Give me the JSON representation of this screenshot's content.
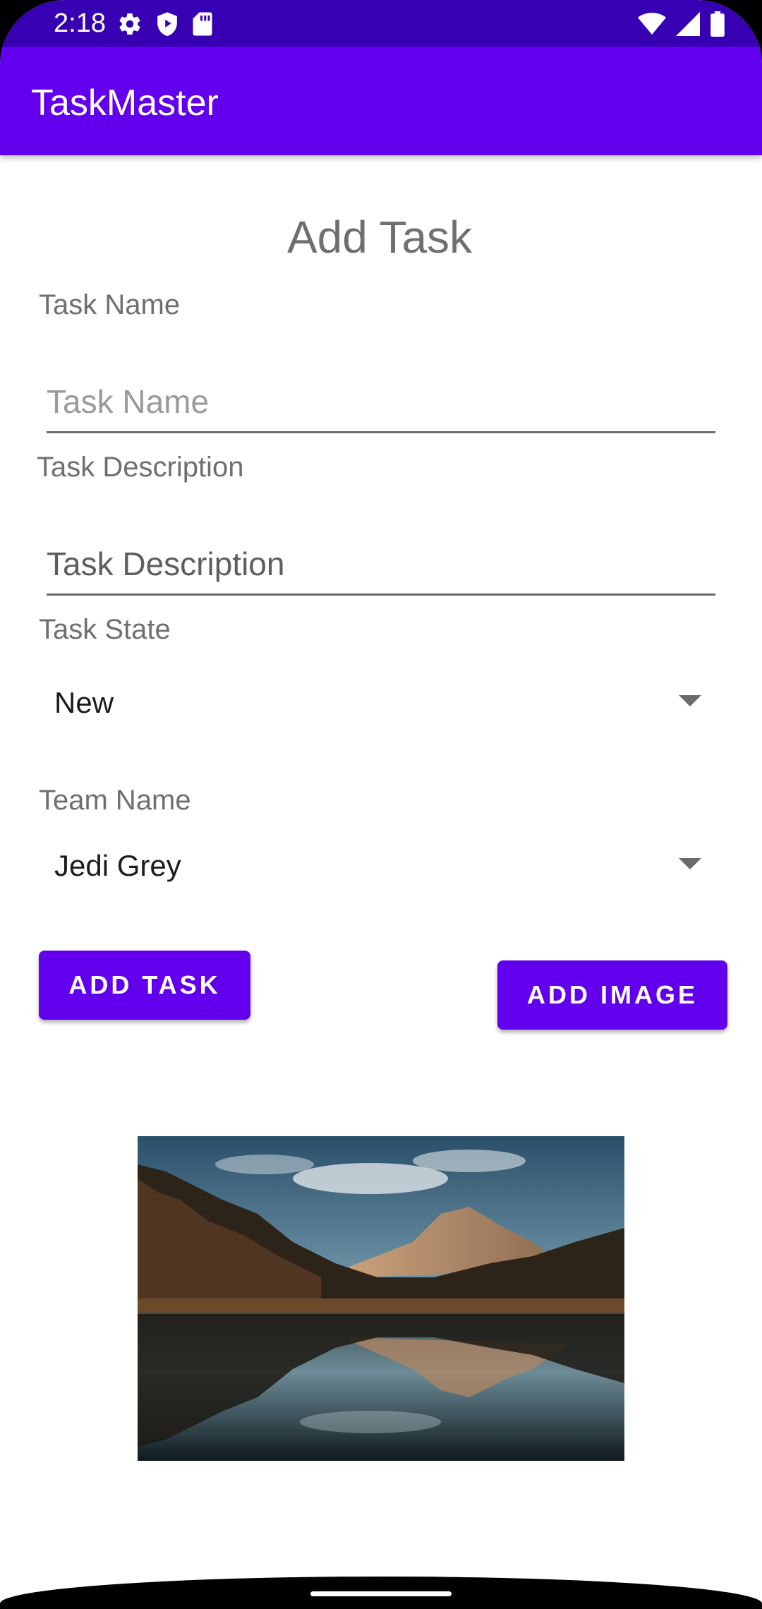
{
  "status_bar": {
    "time": "2:18",
    "left_icons": [
      "gear-icon",
      "play-protect-icon",
      "sd-card-icon"
    ],
    "right_icons": [
      "wifi-icon",
      "cell-signal-icon",
      "battery-icon"
    ],
    "background_color": "#3700b3"
  },
  "app_bar": {
    "title": "TaskMaster",
    "background_color": "#6200ee"
  },
  "form": {
    "title": "Add Task",
    "task_name": {
      "label": "Task Name",
      "placeholder": "Task Name",
      "value": ""
    },
    "task_description": {
      "label": "Task Description",
      "placeholder": "Task Description",
      "value": ""
    },
    "task_state": {
      "label": "Task State",
      "selected": "New"
    },
    "team_name": {
      "label": "Team Name",
      "selected": "Jedi Grey"
    },
    "add_task_button": "ADD TASK",
    "add_image_button": "ADD IMAGE",
    "accent_color": "#6200ee"
  },
  "image": {
    "subject": "mountain lake reflection landscape photo"
  }
}
